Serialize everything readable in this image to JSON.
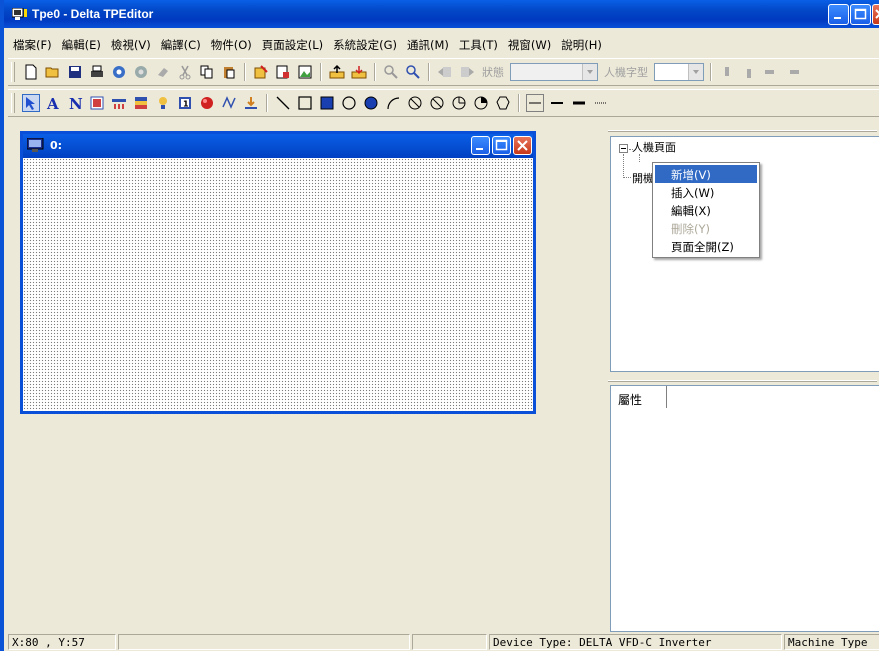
{
  "window": {
    "title": "Tpe0 - Delta TPEditor"
  },
  "menu": {
    "items": [
      "檔案(F)",
      "編輯(E)",
      "檢視(V)",
      "編譯(C)",
      "物件(O)",
      "頁面設定(L)",
      "系統設定(G)",
      "通訊(M)",
      "工具(T)",
      "視窗(W)",
      "說明(H)"
    ]
  },
  "toolbar": {
    "state_label": "狀態",
    "hmi_font_label": "人機字型"
  },
  "child_window": {
    "title": "0:"
  },
  "tree": {
    "root_label": "人機頁面",
    "second_label": "開機"
  },
  "context_menu": {
    "items": [
      {
        "label": "新增(V)",
        "state": "highlighted"
      },
      {
        "label": "插入(W)",
        "state": "normal"
      },
      {
        "label": "編輯(X)",
        "state": "normal"
      },
      {
        "label": "刪除(Y)",
        "state": "disabled"
      },
      {
        "label": "頁面全開(Z)",
        "state": "normal"
      }
    ]
  },
  "properties": {
    "tab_label": "屬性"
  },
  "statusbar": {
    "coords": "X:80 , Y:57",
    "device_type": "Device Type: DELTA VFD-C Inverter",
    "machine_type": "Machine Type"
  },
  "colors": {
    "titlebar": "#0246c6",
    "menu_highlight": "#316ac5",
    "chrome": "#ece9d8"
  }
}
